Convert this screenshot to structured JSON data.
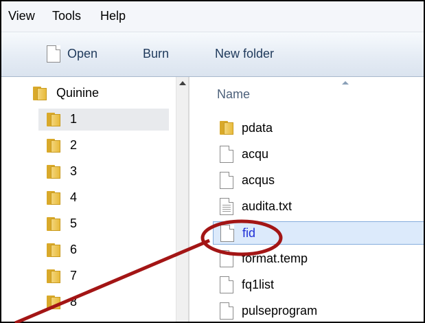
{
  "menubar": {
    "items": [
      "View",
      "Tools",
      "Help"
    ]
  },
  "toolbar": {
    "open_label": "Open",
    "burn_label": "Burn",
    "new_folder_label": "New folder"
  },
  "nav_pane": {
    "items": [
      {
        "label": "Quinine",
        "icon": "folder-icon"
      },
      {
        "label": "1",
        "icon": "folder-icon",
        "selected": true
      },
      {
        "label": "2",
        "icon": "folder-icon"
      },
      {
        "label": "3",
        "icon": "folder-icon"
      },
      {
        "label": "4",
        "icon": "folder-icon"
      },
      {
        "label": "5",
        "icon": "folder-icon"
      },
      {
        "label": "6",
        "icon": "folder-icon"
      },
      {
        "label": "7",
        "icon": "folder-icon"
      },
      {
        "label": "8",
        "icon": "folder-icon"
      }
    ]
  },
  "file_list": {
    "column_header": "Name",
    "files": [
      {
        "name": "pdata",
        "icon": "folder-icon"
      },
      {
        "name": "acqu",
        "icon": "file-icon"
      },
      {
        "name": "acqus",
        "icon": "file-icon"
      },
      {
        "name": "audita.txt",
        "icon": "text-file-icon"
      },
      {
        "name": "fid",
        "icon": "file-icon",
        "selected": true
      },
      {
        "name": "format.temp",
        "icon": "file-icon"
      },
      {
        "name": "fq1list",
        "icon": "file-icon"
      },
      {
        "name": "pulseprogram",
        "icon": "file-icon"
      }
    ]
  },
  "annotation": {
    "color": "#a31515"
  }
}
